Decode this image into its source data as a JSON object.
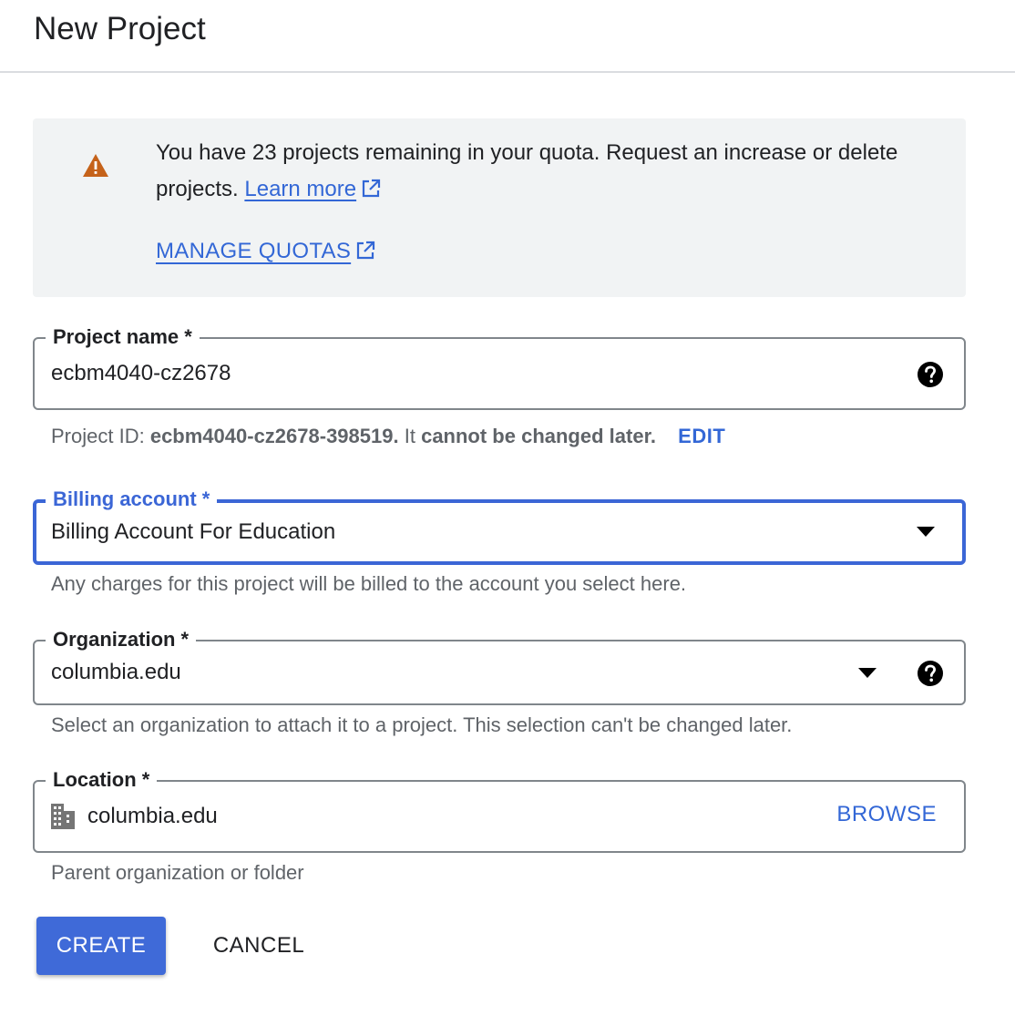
{
  "header": {
    "title": "New Project"
  },
  "quota_banner": {
    "message": "You have 23 projects remaining in your quota. Request an increase or delete projects.",
    "learn_more_label": "Learn more",
    "manage_quotas_label": "MANAGE QUOTAS",
    "warning_color": "#c5621a"
  },
  "project_name": {
    "label": "Project name *",
    "value": "ecbm4040-cz2678",
    "id_prefix": "Project ID:",
    "id_value": "ecbm4040-cz2678-398519.",
    "id_it": "It",
    "id_suffix": "cannot be changed later.",
    "edit_label": "EDIT"
  },
  "billing_account": {
    "label": "Billing account *",
    "value": "Billing Account For Education",
    "hint": "Any charges for this project will be billed to the account you select here."
  },
  "organization": {
    "label": "Organization *",
    "value": "columbia.edu",
    "hint": "Select an organization to attach it to a project. This selection can't be changed later."
  },
  "location": {
    "label": "Location *",
    "value": "columbia.edu",
    "browse_label": "BROWSE",
    "hint": "Parent organization or folder"
  },
  "actions": {
    "create_label": "CREATE",
    "cancel_label": "CANCEL"
  },
  "colors": {
    "accent": "#3367d6",
    "focused_border": "#3b66d6",
    "primary_button": "#3f6ad8",
    "banner_background": "#f1f3f4"
  }
}
